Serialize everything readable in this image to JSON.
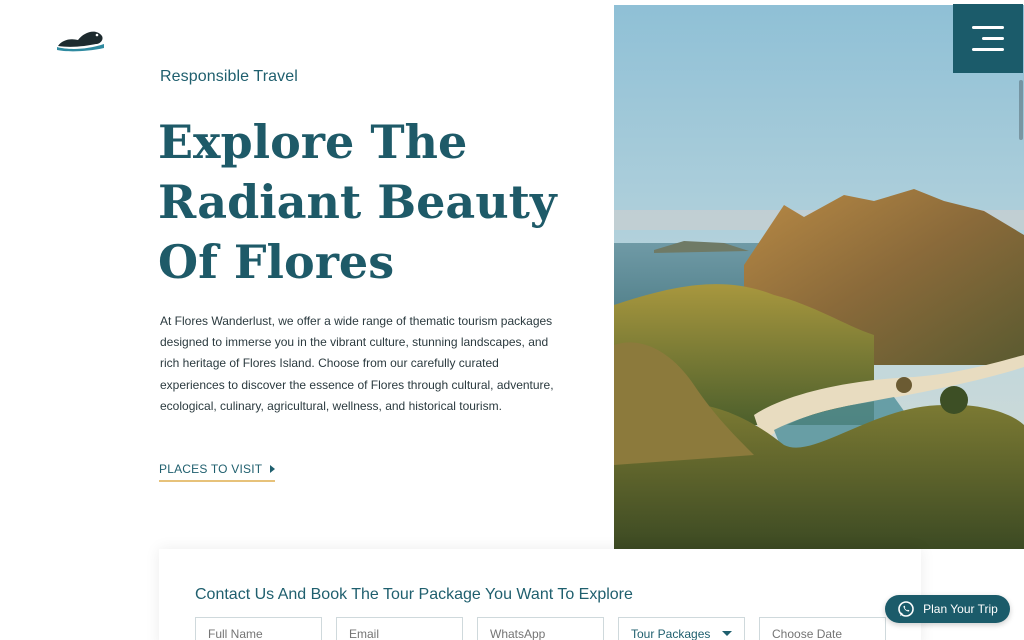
{
  "brand": {
    "logo_icon": "turtle-logo-icon"
  },
  "hero": {
    "eyebrow": "Responsible Travel",
    "title_line1": "Explore The",
    "title_line2": "Radiant Beauty",
    "title_line3": "Of Flores",
    "description": "At Flores Wanderlust, we offer a wide range of thematic tourism packages designed to immerse you in the vibrant culture, stunning landscapes, and rich heritage of Flores Island. Choose from our carefully curated experiences to discover the essence of Flores through cultural, adventure, ecological, culinary, agricultural, wellness, and historical tourism.",
    "cta_label": "PLACES TO VISIT",
    "cta_icon": "play-arrow-icon",
    "image": "padar-island-landscape"
  },
  "menu": {
    "icon": "hamburger-menu-icon"
  },
  "booking_form": {
    "title": "Contact Us And Book The Tour Package You Want To Explore",
    "full_name_placeholder": "Full Name",
    "email_placeholder": "Email",
    "whatsapp_placeholder": "WhatsApp",
    "tour_packages_selected": "Tour Packages",
    "date_placeholder": "Choose Date"
  },
  "floating_button": {
    "label": "Plan Your Trip",
    "icon": "whatsapp-icon"
  },
  "colors": {
    "primary": "#1b5b6a",
    "accent_underline": "#e7c27a",
    "text_body": "#2b3a3f"
  }
}
